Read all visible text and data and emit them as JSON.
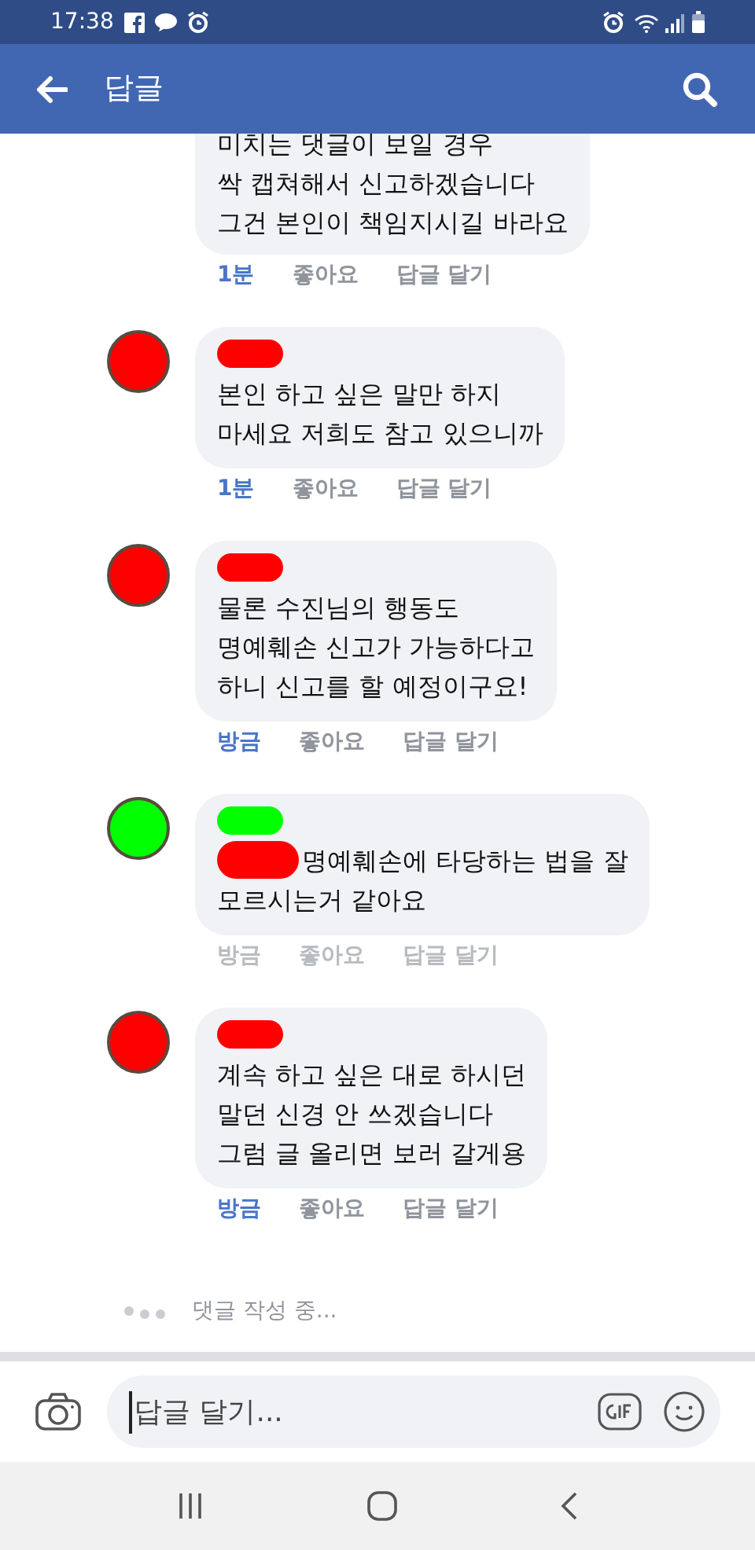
{
  "status_bar": {
    "time": "17:38"
  },
  "header": {
    "title": "답글"
  },
  "comments": [
    {
      "kind": "partial",
      "text": "미치는 댓글이 보일 경우\n싹 캡쳐해서 신고하겠습니다\n그건 본인이 책임지시길 바라요",
      "time": "1분",
      "pending": false,
      "like": "좋아요",
      "reply": "답글 달기"
    },
    {
      "kind": "full",
      "color": "#ff0000",
      "mention": false,
      "text": "본인 하고 싶은 말만 하지\n마세요 저희도 참고 있으니까",
      "time": "1분",
      "pending": false,
      "like": "좋아요",
      "reply": "답글 달기"
    },
    {
      "kind": "full",
      "color": "#ff0000",
      "mention": false,
      "text": "물론 수진님의 행동도\n명예훼손 신고가 가능하다고\n하니 신고를 할 예정이구요!",
      "time": "방금",
      "pending": false,
      "like": "좋아요",
      "reply": "답글 달기"
    },
    {
      "kind": "full",
      "color": "#00ff00",
      "mention": true,
      "text": "명예훼손에 타당하는 법을 잘\n모르시는거 같아요",
      "time": "방금",
      "pending": true,
      "like": "좋아요",
      "reply": "답글 달기"
    },
    {
      "kind": "full",
      "color": "#ff0000",
      "mention": false,
      "text": "계속 하고 싶은 대로 하시던\n말던 신경 안 쓰겠습니다\n그럼 글 올리면 보러 갈게용",
      "time": "방금",
      "pending": false,
      "like": "좋아요",
      "reply": "답글 달기"
    }
  ],
  "typing": "댓글 작성 중...",
  "composer": {
    "placeholder": "답글 달기..."
  }
}
